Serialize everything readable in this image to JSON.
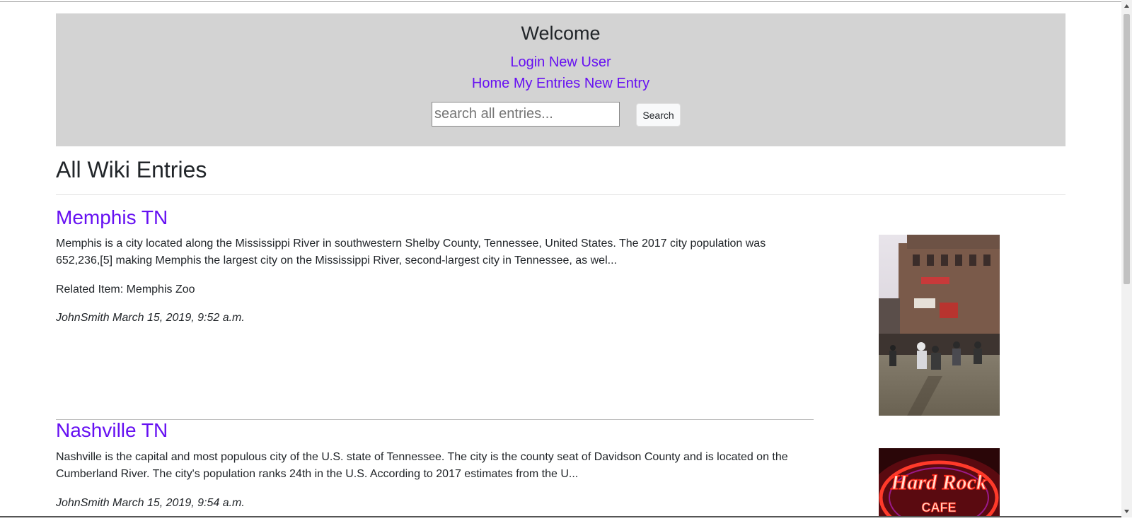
{
  "header": {
    "welcome": "Welcome",
    "auth_links": [
      "Login",
      "New User"
    ],
    "nav_links": [
      "Home",
      "My Entries",
      "New Entry"
    ],
    "search": {
      "placeholder": "search all entries...",
      "value": "",
      "button_label": "Search"
    }
  },
  "page": {
    "title": "All Wiki Entries"
  },
  "entries": [
    {
      "title": "Memphis TN",
      "text": "Memphis is a city located along the Mississippi River in southwestern Shelby County, Tennessee, United States. The 2017 city population was 652,236,[5] making Memphis the largest city on the Mississippi River, second-largest city in Tennessee, as wel...",
      "related": "Related Item: Memphis Zoo",
      "meta": "JohnSmith March 15, 2019, 9:52 a.m."
    },
    {
      "title": "Nashville TN",
      "text": "Nashville is the capital and most populous city of the U.S. state of Tennessee. The city is the county seat of Davidson County and is located on the Cumberland River. The city's population ranks 24th in the U.S. According to 2017 estimates from the U...",
      "meta": "JohnSmith March 15, 2019, 9:54 a.m."
    }
  ],
  "thumb_text": [
    "Hard Rock",
    "CAFE"
  ],
  "colors": {
    "link": "#6610f2",
    "header_bg": "#d3d3d3",
    "text": "#212529"
  }
}
